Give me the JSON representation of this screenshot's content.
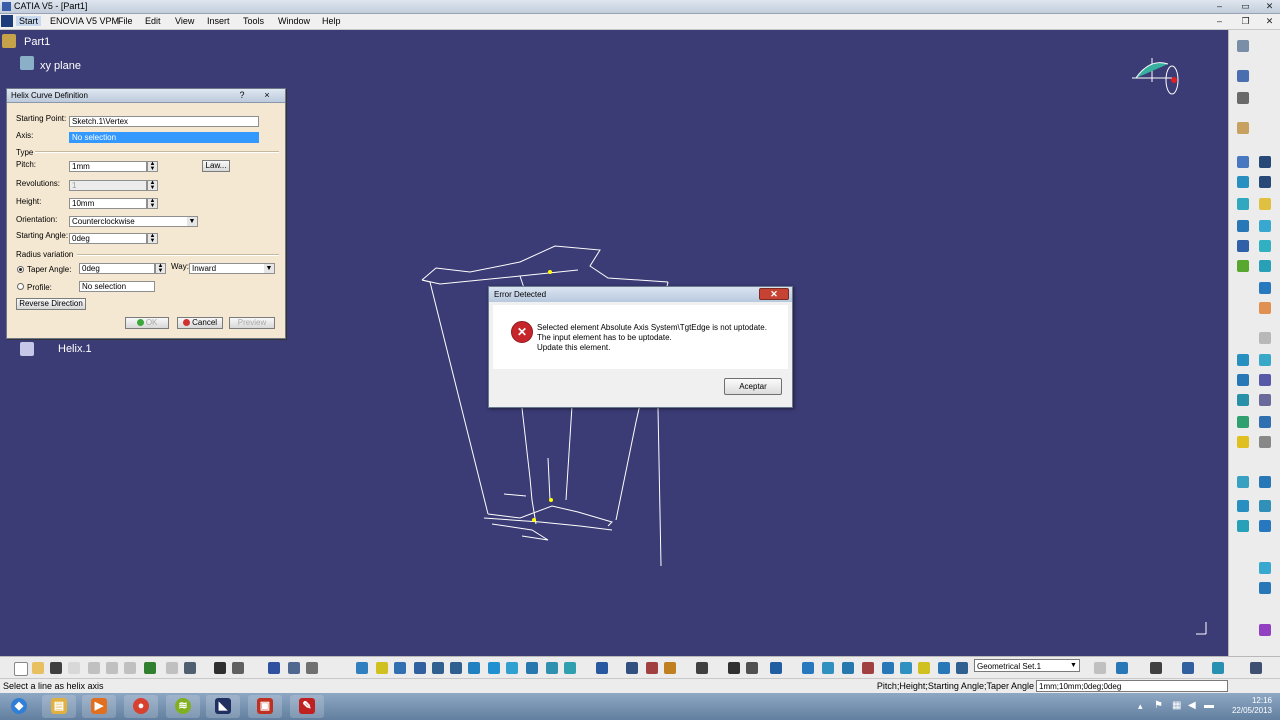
{
  "window": {
    "title": "CATIA V5 - [Part1]"
  },
  "menu": {
    "items": [
      "Start",
      "ENOVIA V5 VPM",
      "File",
      "Edit",
      "View",
      "Insert",
      "Tools",
      "Window",
      "Help"
    ]
  },
  "tree": {
    "root": "Part1",
    "plane": "xy plane",
    "helix": "Helix.1"
  },
  "helix_dialog": {
    "title": "Helix Curve Definition",
    "help_button": "?",
    "close_button": "×",
    "starting_point_label": "Starting Point:",
    "starting_point_value": "Sketch.1\\Vertex",
    "axis_label": "Axis:",
    "axis_value": "No selection",
    "type_label": "Type",
    "pitch_label": "Pitch:",
    "pitch_value": "1mm",
    "law_button": "Law...",
    "revolutions_label": "Revolutions:",
    "revolutions_value": "1",
    "height_label": "Height:",
    "height_value": "10mm",
    "orientation_label": "Orientation:",
    "orientation_value": "Counterclockwise",
    "starting_angle_label": "Starting Angle:",
    "starting_angle_value": "0deg",
    "radius_variation_label": "Radius variation",
    "taper_angle_label": "Taper Angle:",
    "taper_angle_value": "0deg",
    "way_label": "Way:",
    "way_value": "Inward",
    "profile_label": "Profile:",
    "profile_value": "No selection",
    "reverse_direction_button": "Reverse Direction",
    "ok_button": "OK",
    "cancel_button": "Cancel",
    "preview_button": "Preview"
  },
  "error_dialog": {
    "title": "Error Detected",
    "line1": "Selected element Absolute Axis System\\TgtEdge is not uptodate.",
    "line2": "The input element has to be uptodate.",
    "line3": "Update this element.",
    "accept_button": "Aceptar"
  },
  "toolbar": {
    "geometrical_set": "Geometrical Set.1"
  },
  "status": {
    "message": "Select a line as helix axis",
    "params_label": "Pitch;Height;Starting Angle;Taper Angle",
    "params_value": "1mm;10mm;0deg;0deg"
  },
  "taskbar": {
    "time": "12:16",
    "date": "22/05/2013"
  }
}
